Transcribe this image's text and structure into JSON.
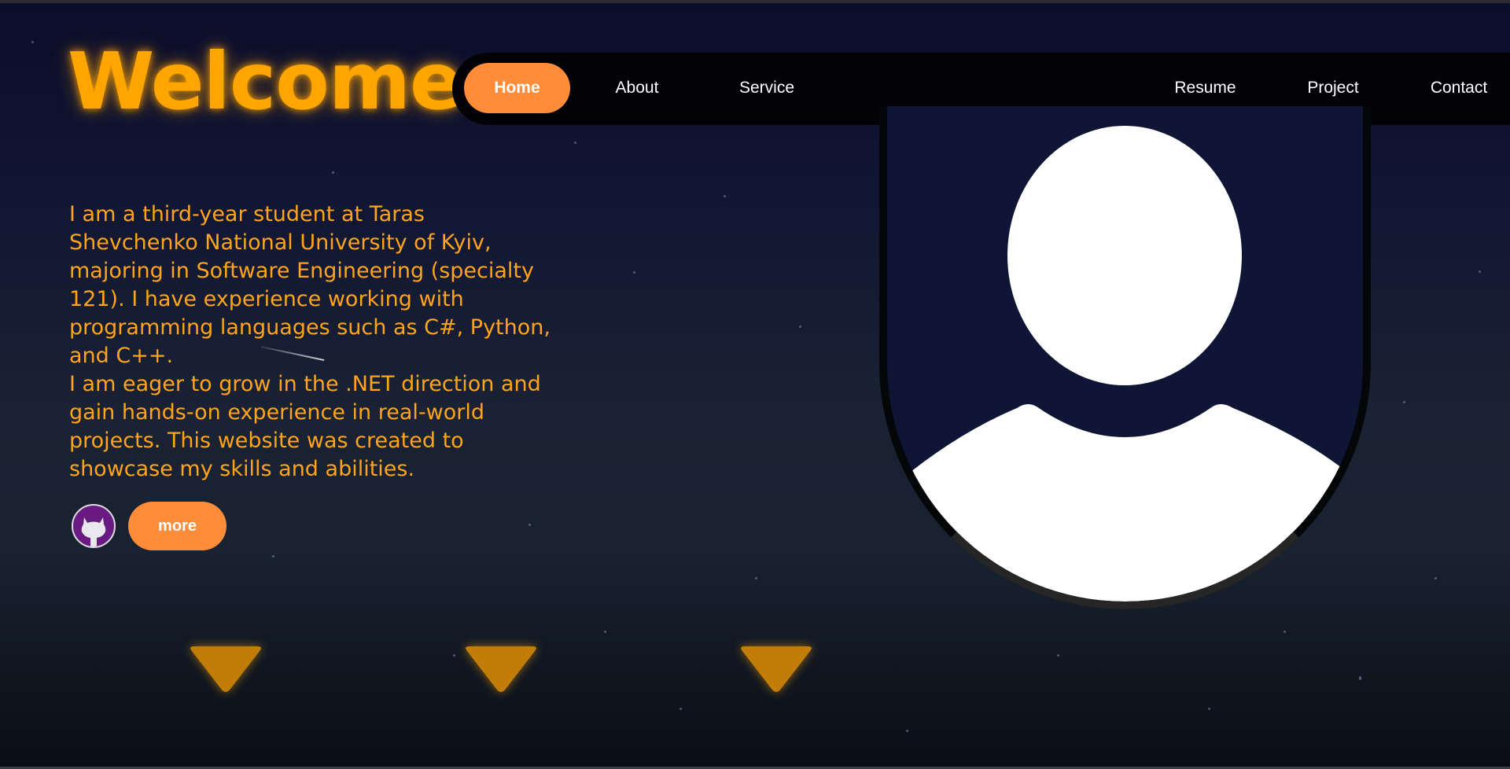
{
  "header": {
    "title": "Welcome"
  },
  "nav": {
    "items": [
      {
        "label": "Home",
        "active": true
      },
      {
        "label": "About"
      },
      {
        "label": "Service"
      },
      {
        "label": "Resume"
      },
      {
        "label": "Project"
      },
      {
        "label": "Contact"
      }
    ]
  },
  "hero": {
    "bio_paragraph_1": "I am a third-year student at Taras Shevchenko National University of Kyiv, majoring in Software Engineering (specialty 121). I have experience working with programming languages such as C#, Python, and C++.",
    "bio_paragraph_2": "I am eager to grow in the .NET direction and gain hands-on experience in real-world projects. This website was created to showcase my skills and abilities.",
    "more_label": "more",
    "github_icon": "github-icon",
    "avatar_icon": "user-placeholder-icon"
  },
  "scroll_arrows": [
    "chevron-down-icon",
    "chevron-down-icon",
    "chevron-down-icon"
  ],
  "colors": {
    "accent": "#ffa500",
    "button": "#ff8c38",
    "nav_bg": "#030307",
    "github_bg": "#6a1b82"
  }
}
